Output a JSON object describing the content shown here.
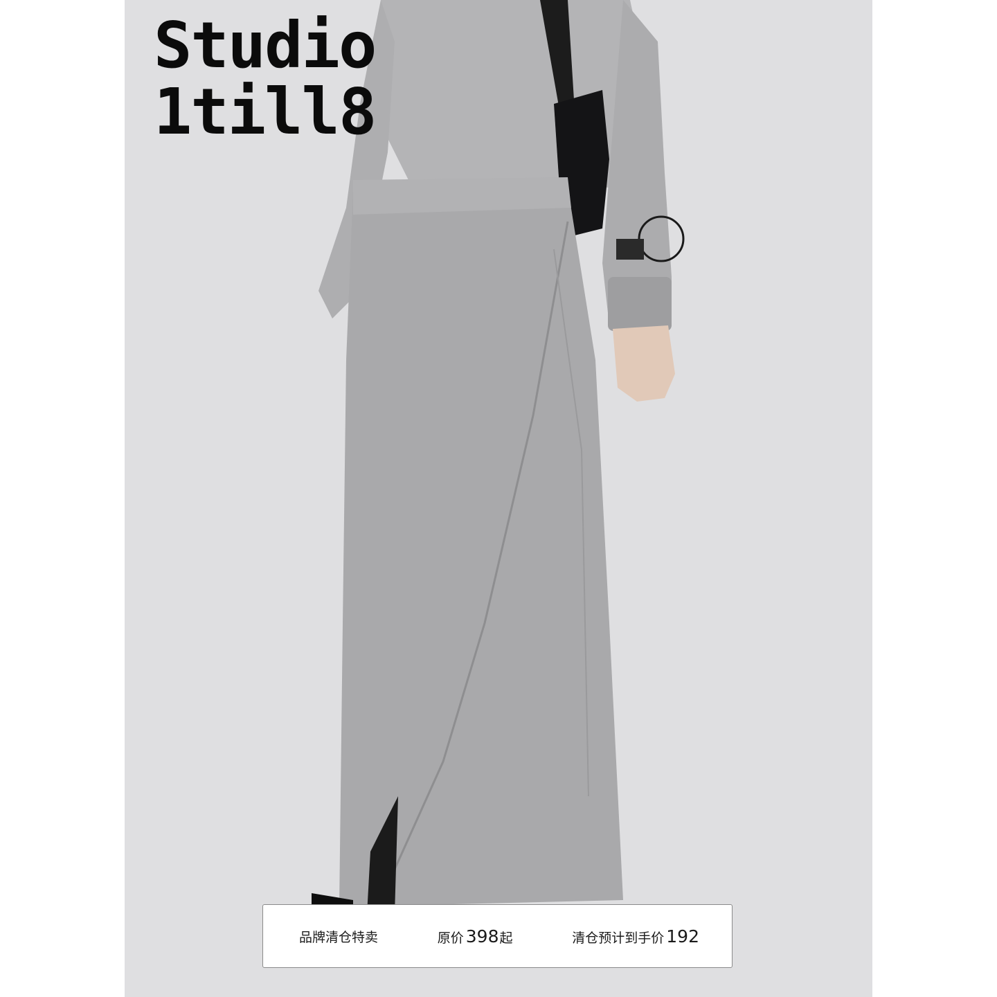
{
  "brand": {
    "line1": "Studio",
    "line2": "1till8"
  },
  "price_bar": {
    "clearance_label": "品牌清仓特卖",
    "original_prefix": "原价",
    "original_price": "398",
    "original_suffix": "起",
    "final_label": "清仓预计到手价",
    "final_price": "192"
  },
  "colors": {
    "background": "#dfdfe1",
    "garment": "#a9a9ab",
    "brand_text": "#0b0b0b"
  }
}
